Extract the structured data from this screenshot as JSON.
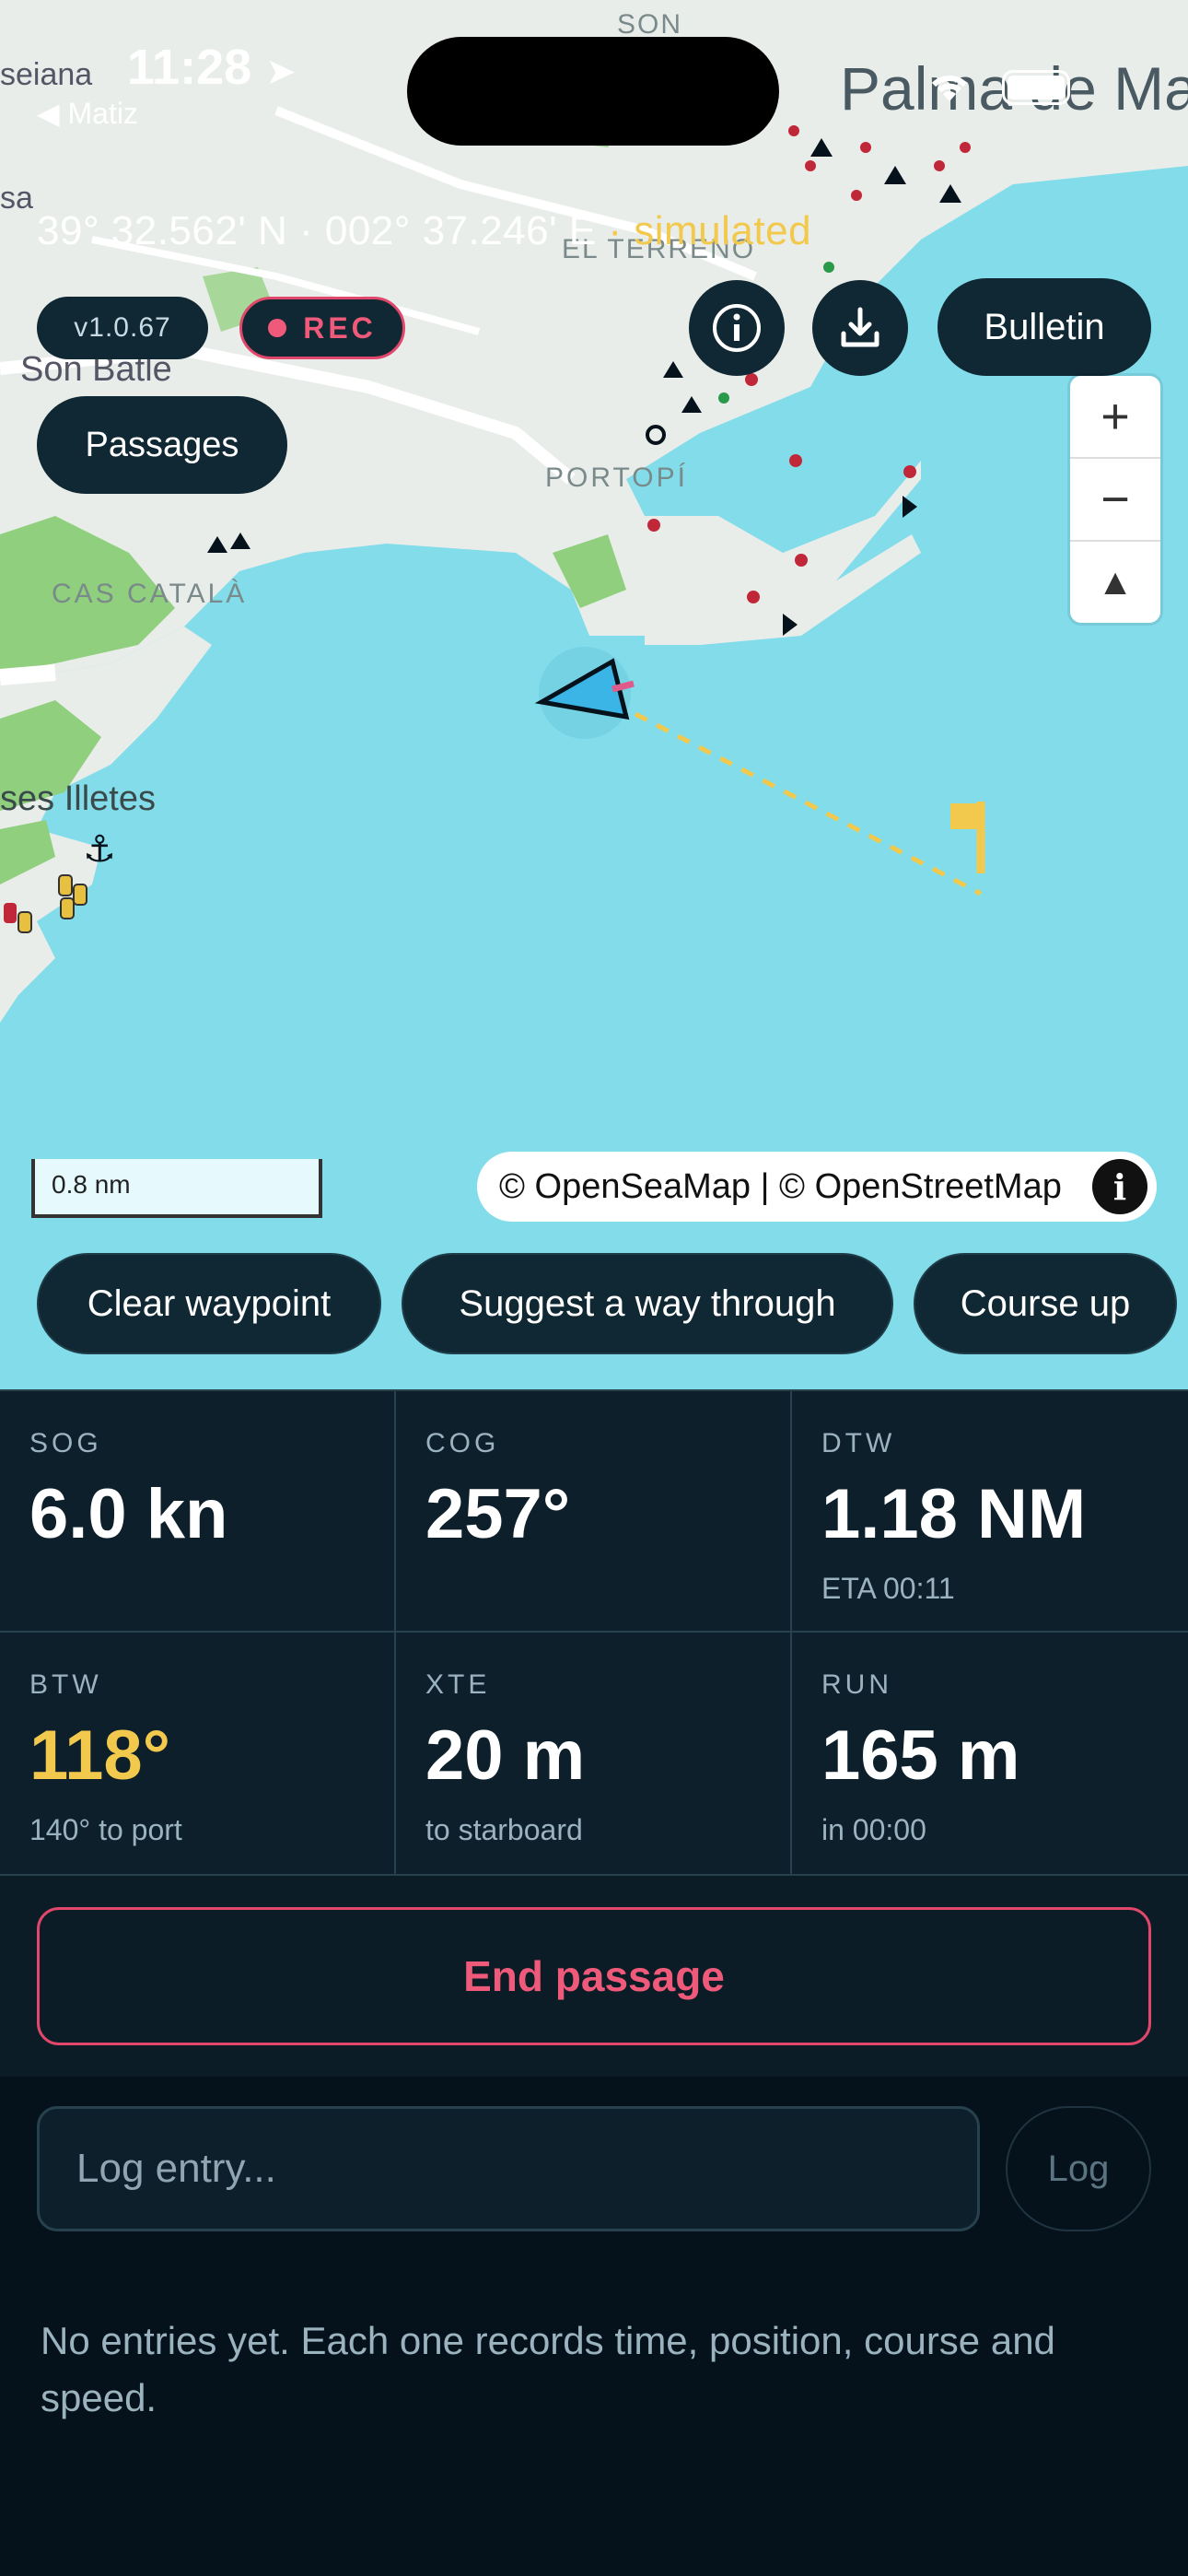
{
  "status_bar": {
    "time": "11:28",
    "back_app": "◀ Matiz"
  },
  "map": {
    "coords": "39° 32.562' N · 002° 37.246' E",
    "coords_sep": " · ",
    "sim_label": "simulated",
    "place_labels": {
      "son": "SON",
      "seiana": "seiana",
      "sa": "sa",
      "palma": "Palma de Ma",
      "el_terreno": "EL TERRENO",
      "son_batle": "Son Batle",
      "portopi": "PORTOPÍ",
      "cas_catala": "CAS CATALÀ",
      "ses_illetes": "ses Illetes"
    },
    "version": "v1.0.67",
    "rec_label": "REC",
    "bulletin_label": "Bulletin",
    "passages_label": "Passages",
    "zoom_in": "+",
    "zoom_out": "−",
    "compass": "▲",
    "scale_label": "0.8 nm",
    "attribution": "© OpenSeaMap | © OpenStreetMap",
    "attribution_info": "i",
    "buttons": {
      "clear_waypoint": "Clear waypoint",
      "suggest": "Suggest a way through",
      "course_up": "Course up"
    },
    "colors": {
      "sea": "#82dcea",
      "land": "#e8ece8",
      "park": "#8fcf7d",
      "accent": "#f2c94c",
      "rec": "#f05a7a"
    }
  },
  "stats": [
    {
      "label": "SOG",
      "value": "6.0 kn",
      "sub": ""
    },
    {
      "label": "COG",
      "value": "257°",
      "sub": ""
    },
    {
      "label": "DTW",
      "value": "1.18 NM",
      "sub": "ETA 00:11"
    },
    {
      "label": "BTW",
      "value": "118°",
      "sub": "140° to port"
    },
    {
      "label": "XTE",
      "value": "20 m",
      "sub": "to starboard"
    },
    {
      "label": "RUN",
      "value": "165 m",
      "sub": "in 00:00"
    }
  ],
  "end_passage_label": "End passage",
  "log": {
    "placeholder": "Log entry...",
    "button": "Log"
  },
  "empty_message": "No entries yet. Each one records time, position, course and speed."
}
